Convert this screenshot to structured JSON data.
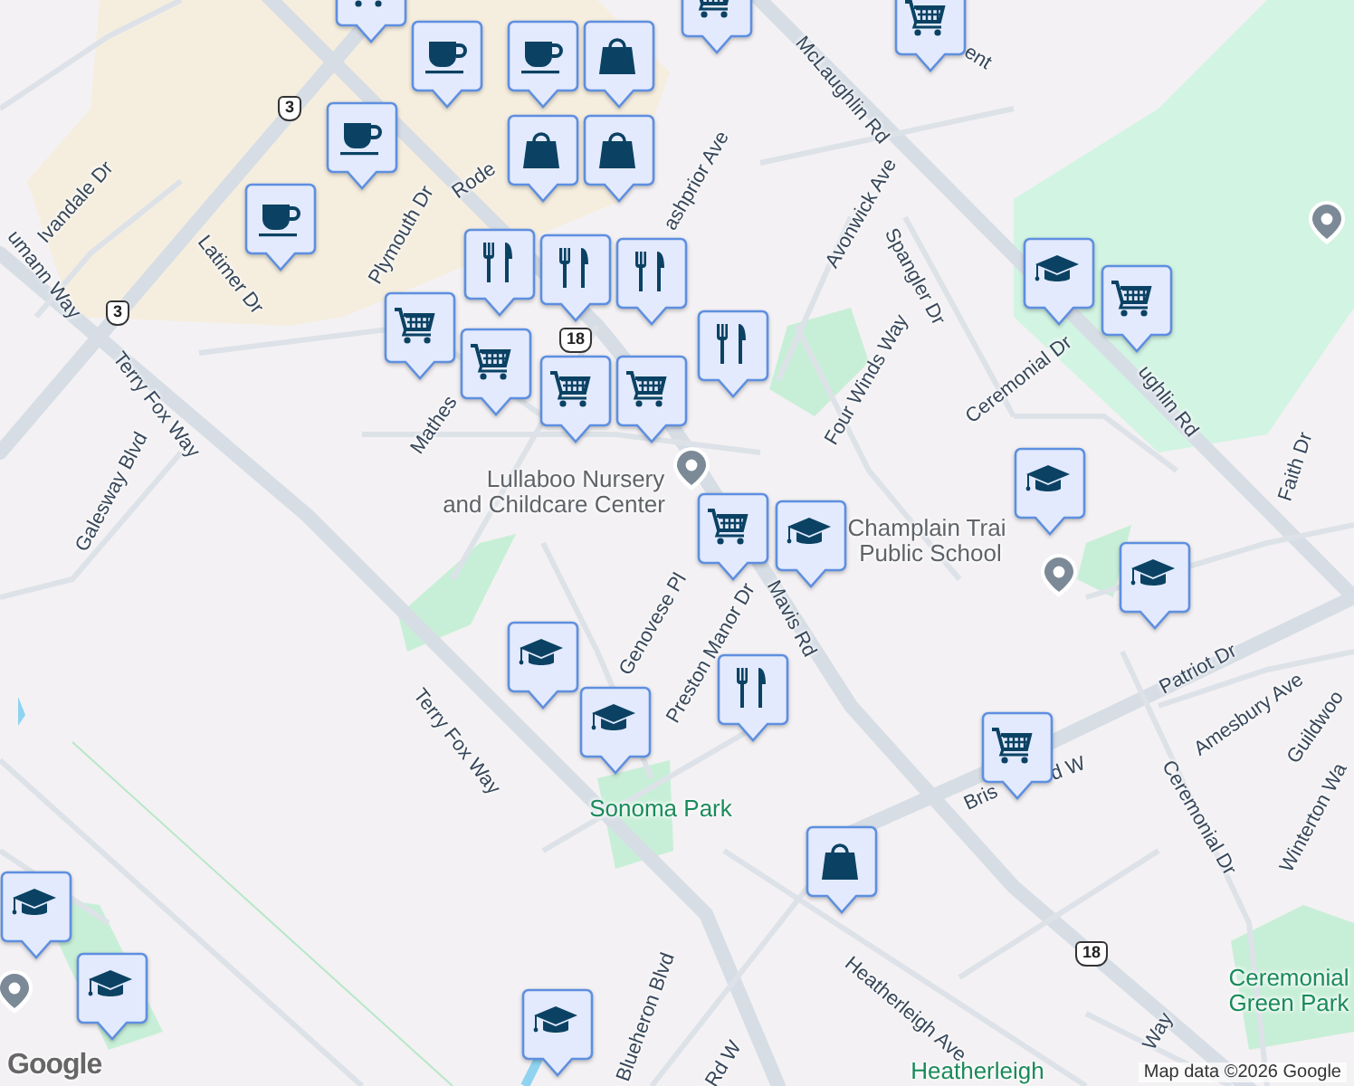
{
  "map": {
    "labels": [
      {
        "text": "Ivandale Dr",
        "kind": "street"
      },
      {
        "text": "umann Way",
        "kind": "street"
      },
      {
        "text": "Latimer Dr",
        "kind": "street"
      },
      {
        "text": "Plymouth Dr",
        "kind": "street"
      },
      {
        "text": "Rode",
        "kind": "street"
      },
      {
        "text": "ashprior Ave",
        "kind": "street"
      },
      {
        "text": "McLaughlin Rd",
        "kind": "street"
      },
      {
        "text": "ent",
        "kind": "street"
      },
      {
        "text": "Avonwick Ave",
        "kind": "street"
      },
      {
        "text": "Spangler Dr",
        "kind": "street"
      },
      {
        "text": "Four Winds Way",
        "kind": "street"
      },
      {
        "text": "Ceremonial Dr",
        "kind": "street"
      },
      {
        "text": "ughlin Rd",
        "kind": "street"
      },
      {
        "text": "Faith Dr",
        "kind": "street"
      },
      {
        "text": "Mathes",
        "kind": "street"
      },
      {
        "text": "Terry Fox Way",
        "kind": "street"
      },
      {
        "text": "Galesway Blvd",
        "kind": "street"
      },
      {
        "text": "Lullaboo Nursery",
        "kind": "place"
      },
      {
        "text": "and Childcare Center",
        "kind": "place"
      },
      {
        "text": "Champlain Trai",
        "kind": "place"
      },
      {
        "text": "Public School",
        "kind": "place"
      },
      {
        "text": "Genovese Pl",
        "kind": "street"
      },
      {
        "text": "Preston Manor Dr",
        "kind": "street"
      },
      {
        "text": "Mavis Rd",
        "kind": "street"
      },
      {
        "text": "Terry Fox Way",
        "kind": "street"
      },
      {
        "text": "Sonoma Park",
        "kind": "park"
      },
      {
        "text": "Patriot Dr",
        "kind": "street"
      },
      {
        "text": "Guildwoo",
        "kind": "street"
      },
      {
        "text": "Amesbury Ave",
        "kind": "street"
      },
      {
        "text": "Ceremonial Dr",
        "kind": "street"
      },
      {
        "text": "Winterton Wa",
        "kind": "street"
      },
      {
        "text": "Bris",
        "kind": "street"
      },
      {
        "text": "d W",
        "kind": "street"
      },
      {
        "text": "Heatherleigh Ave",
        "kind": "street"
      },
      {
        "text": "Blueheron Blvd",
        "kind": "street"
      },
      {
        "text": "Rd W",
        "kind": "street"
      },
      {
        "text": "Ceremonial Green Park",
        "kind": "park"
      },
      {
        "text": "Heatherleigh",
        "kind": "park"
      },
      {
        "text": "Way",
        "kind": "street"
      }
    ],
    "shields": [
      "3",
      "3",
      "18",
      "18"
    ],
    "markers": [
      {
        "kind": "grocery"
      },
      {
        "kind": "grocery"
      },
      {
        "kind": "grocery"
      },
      {
        "kind": "cafe"
      },
      {
        "kind": "cafe"
      },
      {
        "kind": "cafe"
      },
      {
        "kind": "cafe"
      },
      {
        "kind": "shopping"
      },
      {
        "kind": "shopping"
      },
      {
        "kind": "shopping"
      },
      {
        "kind": "restaurant"
      },
      {
        "kind": "restaurant"
      },
      {
        "kind": "restaurant"
      },
      {
        "kind": "restaurant"
      },
      {
        "kind": "grocery"
      },
      {
        "kind": "grocery"
      },
      {
        "kind": "grocery"
      },
      {
        "kind": "grocery"
      },
      {
        "kind": "school"
      },
      {
        "kind": "grocery"
      },
      {
        "kind": "grocery"
      },
      {
        "kind": "school"
      },
      {
        "kind": "school"
      },
      {
        "kind": "school"
      },
      {
        "kind": "school"
      },
      {
        "kind": "school"
      },
      {
        "kind": "restaurant"
      },
      {
        "kind": "grocery"
      },
      {
        "kind": "shopping"
      },
      {
        "kind": "school"
      },
      {
        "kind": "school"
      },
      {
        "kind": "school"
      }
    ],
    "attribution": "Map data ©2026 Google",
    "logo": "Google"
  }
}
